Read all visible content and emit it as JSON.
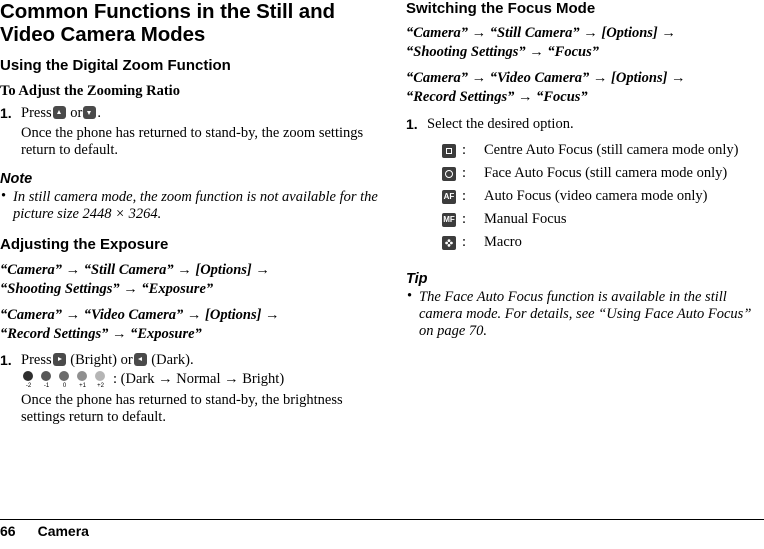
{
  "left": {
    "title": "Common Functions in the Still and Video Camera Modes",
    "section1": "Using the Digital Zoom Function",
    "sub1": "To Adjust the Zooming Ratio",
    "step1_num": "1.",
    "step1_pre": "Press",
    "step1_mid": "or",
    "step1_post": ".",
    "step1_body": "Once the phone has returned to stand-by, the zoom settings return to default.",
    "note_head": "Note",
    "note_bullet": "In still camera mode, the zoom function is not available for the picture size 2448 × 3264.",
    "section2": "Adjusting the Exposure",
    "path1_line1": "“Camera” → “Still Camera” → [Options] →",
    "path1_line2": "“Shooting Settings” → “Exposure”",
    "path2_line1": "“Camera” → “Video Camera” → [Options] →",
    "path2_line2": "“Record Settings” → “Exposure”",
    "step2_num": "1.",
    "step2_pre": "Press",
    "step2_bright": "(Bright) or",
    "step2_dark": "(Dark).",
    "expo_labels": [
      "-2",
      "-1",
      "0",
      "+1",
      "+2"
    ],
    "expo_caption": ": (Dark → Normal → Bright)",
    "step2_body": "Once the phone has returned to stand-by, the brightness settings return to default."
  },
  "right": {
    "section1": "Switching the Focus Mode",
    "path1_line1": "“Camera” → “Still Camera” → [Options] →",
    "path1_line2": "“Shooting Settings” → “Focus”",
    "path2_line1": "“Camera” → “Video Camera” → [Options] →",
    "path2_line2": "“Record Settings” → “Focus”",
    "step1_num": "1.",
    "step1_text": "Select the desired option.",
    "focus_rows": [
      {
        "icon": "centre-auto-focus-icon",
        "colon": ":",
        "desc": "Centre Auto Focus (still camera mode only)"
      },
      {
        "icon": "face-auto-focus-icon",
        "colon": ":",
        "desc": "Face Auto Focus (still camera mode only)"
      },
      {
        "icon": "auto-focus-icon",
        "colon": ":",
        "desc": "Auto Focus (video camera mode only)"
      },
      {
        "icon": "manual-focus-icon",
        "colon": ":",
        "desc": "Manual Focus"
      },
      {
        "icon": "macro-focus-icon",
        "colon": ":",
        "desc": "Macro"
      }
    ],
    "tip_head": "Tip",
    "tip_bullet": "The Face Auto Focus function is available in the still camera mode. For details, see “Using Face Auto Focus” on page 70."
  },
  "footer": {
    "page_number": "66",
    "chapter": "Camera"
  }
}
